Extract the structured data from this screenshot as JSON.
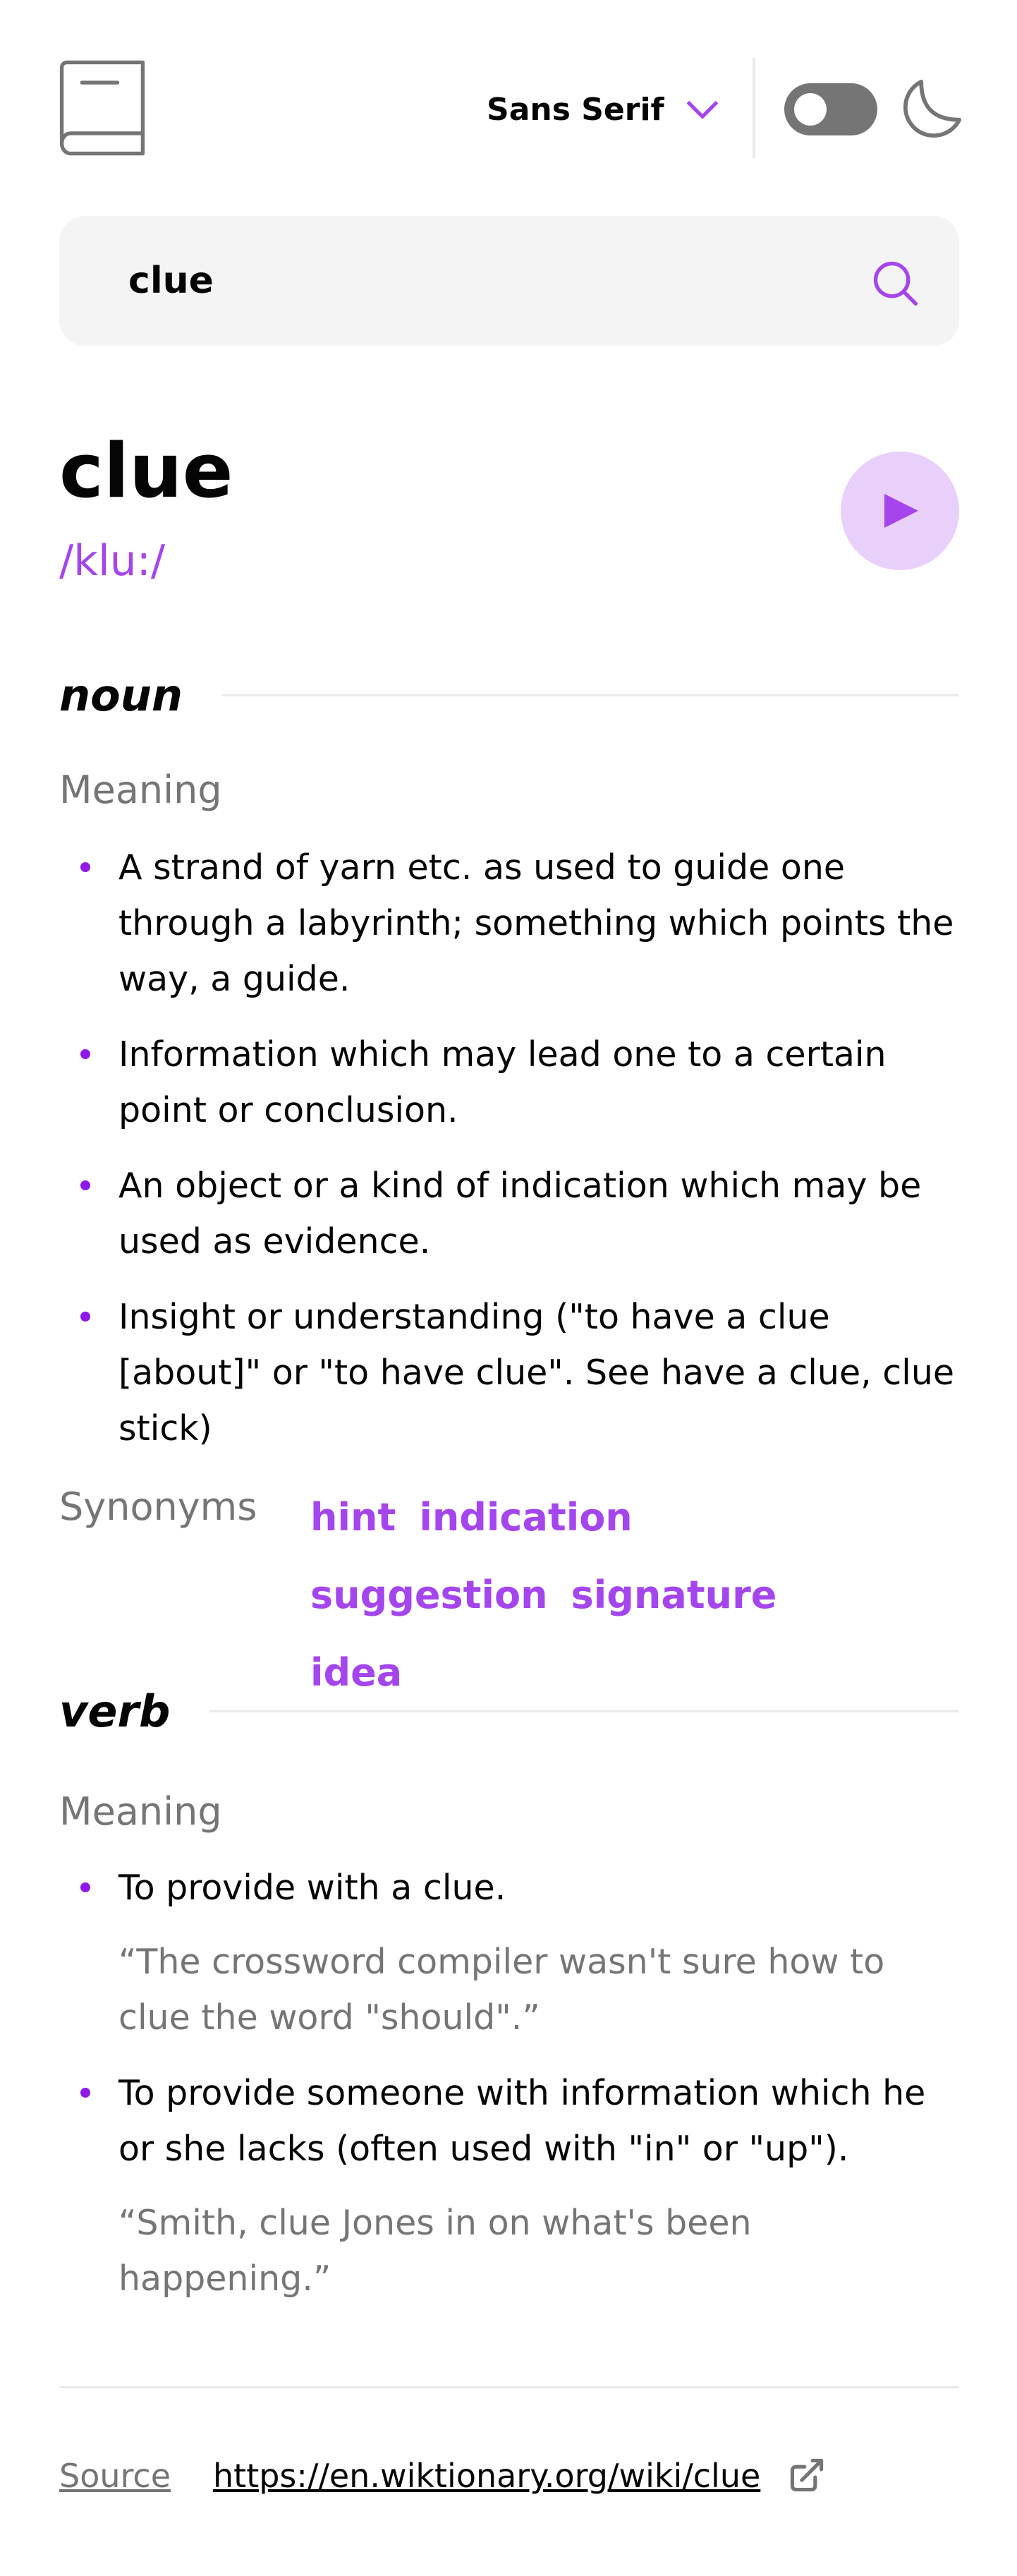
{
  "header": {
    "logo_icon": "book-icon",
    "font_selector": {
      "label": "Sans Serif",
      "icon": "chevron-down-icon"
    },
    "theme_toggle": {
      "state": "off"
    },
    "theme_icon": "moon-icon"
  },
  "search": {
    "value": "clue",
    "icon": "search-icon"
  },
  "entry": {
    "word": "clue",
    "phonetic": "/klu:/",
    "play_icon": "play-icon",
    "meanings": [
      {
        "part_of_speech": "noun",
        "meaning_label": "Meaning",
        "definitions": [
          {
            "text": "A strand of yarn etc. as used to guide one through a labyrinth; something which points the way, a guide."
          },
          {
            "text": "Information which may lead one to a certain point or conclusion."
          },
          {
            "text": "An object or a kind of indication which may be used as evidence."
          },
          {
            "text": "Insight or understanding (\"to have a clue [about]\" or \"to have clue\". See have a clue, clue stick)"
          }
        ],
        "synonyms_label": "Synonyms",
        "synonyms": [
          "hint",
          "indication",
          "suggestion",
          "signature",
          "idea"
        ]
      },
      {
        "part_of_speech": "verb",
        "meaning_label": "Meaning",
        "definitions": [
          {
            "text": "To provide with a clue.",
            "example": "“The crossword compiler wasn't sure how to clue the word \"should\".”"
          },
          {
            "text": "To provide someone with information which he or she lacks (often used with \"in\" or \"up\").",
            "example": "“Smith, clue Jones in on what's been happening.”"
          }
        ]
      }
    ]
  },
  "source": {
    "label": "Source",
    "url": "https://en.wiktionary.org/wiki/clue",
    "icon": "external-link-icon"
  },
  "colors": {
    "accent": "#a445ed",
    "accent_light": "#e9d0fa",
    "bullet": "#8f19e8",
    "muted": "#757575",
    "text": "#050505",
    "surface": "#f4f4f4",
    "divider": "#e9e9e9"
  }
}
